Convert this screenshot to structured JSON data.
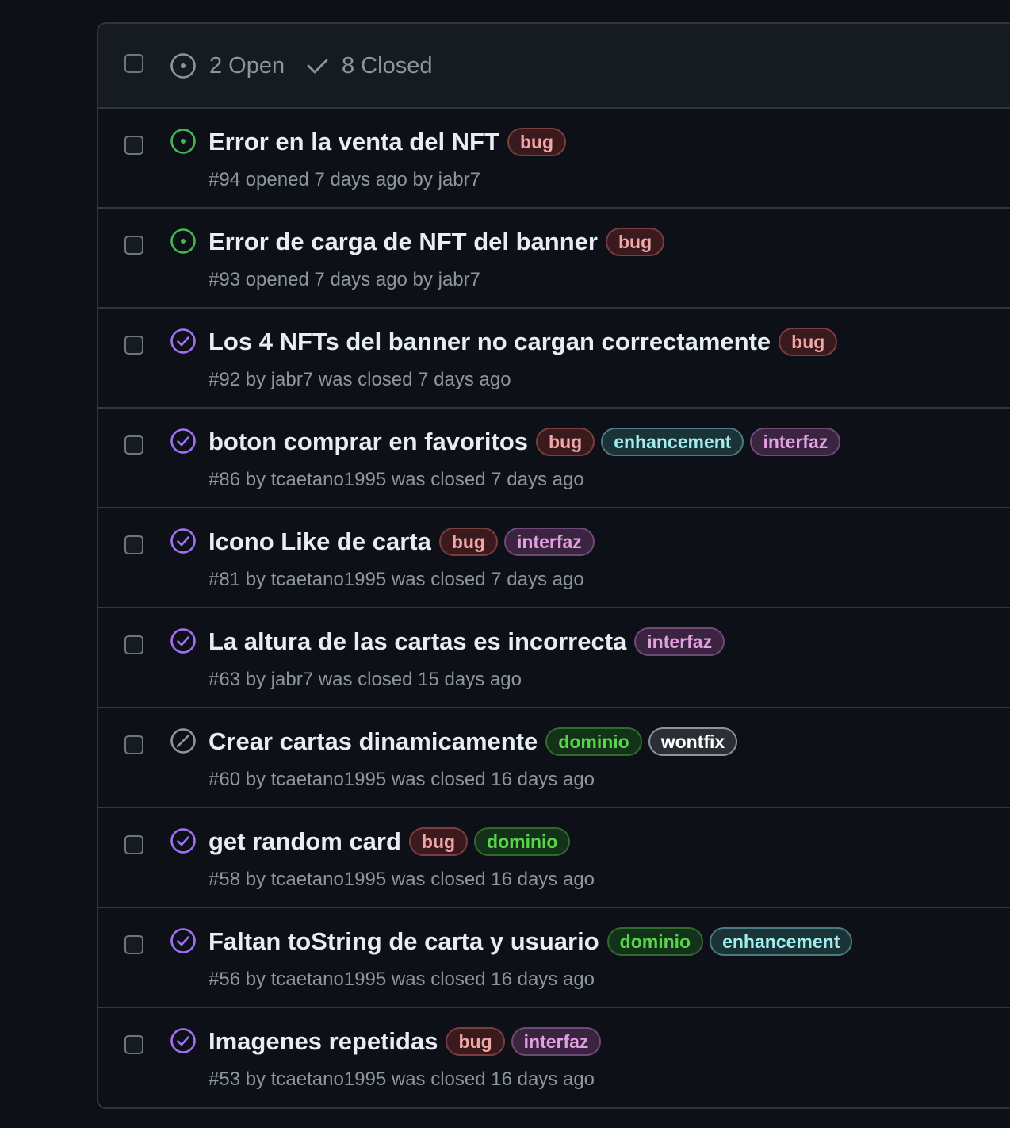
{
  "header": {
    "open_label": "2 Open",
    "closed_label": "8 Closed"
  },
  "colors": {
    "open": "#3fb950",
    "closed": "#a371f7",
    "not_planned": "#8d96a0"
  },
  "issues": [
    {
      "title": "Error en la venta del NFT",
      "state": "open",
      "state_icon": "issue-opened-icon",
      "labels": [
        {
          "name": "bug",
          "kind": "bug"
        }
      ],
      "meta": "#94 opened 7 days ago by jabr7"
    },
    {
      "title": "Error de carga de NFT del banner",
      "state": "open",
      "state_icon": "issue-opened-icon",
      "labels": [
        {
          "name": "bug",
          "kind": "bug"
        }
      ],
      "meta": "#93 opened 7 days ago by jabr7"
    },
    {
      "title": "Los 4 NFTs del banner no cargan correctamente",
      "state": "closed",
      "state_icon": "issue-closed-icon",
      "labels": [
        {
          "name": "bug",
          "kind": "bug"
        }
      ],
      "meta": "#92 by jabr7 was closed 7 days ago"
    },
    {
      "title": "boton comprar en favoritos",
      "state": "closed",
      "state_icon": "issue-closed-icon",
      "labels": [
        {
          "name": "bug",
          "kind": "bug"
        },
        {
          "name": "enhancement",
          "kind": "enhancement"
        },
        {
          "name": "interfaz",
          "kind": "interfaz"
        }
      ],
      "meta": "#86 by tcaetano1995 was closed 7 days ago"
    },
    {
      "title": "Icono Like de carta",
      "state": "closed",
      "state_icon": "issue-closed-icon",
      "labels": [
        {
          "name": "bug",
          "kind": "bug"
        },
        {
          "name": "interfaz",
          "kind": "interfaz"
        }
      ],
      "meta": "#81 by tcaetano1995 was closed 7 days ago"
    },
    {
      "title": "La altura de las cartas es incorrecta",
      "state": "closed",
      "state_icon": "issue-closed-icon",
      "labels": [
        {
          "name": "interfaz",
          "kind": "interfaz"
        }
      ],
      "meta": "#63 by jabr7 was closed 15 days ago"
    },
    {
      "title": "Crear cartas dinamicamente",
      "state": "not_planned",
      "state_icon": "skip-icon",
      "labels": [
        {
          "name": "dominio",
          "kind": "dominio"
        },
        {
          "name": "wontfix",
          "kind": "wontfix"
        }
      ],
      "meta": "#60 by tcaetano1995 was closed 16 days ago"
    },
    {
      "title": "get random card",
      "state": "closed",
      "state_icon": "issue-closed-icon",
      "labels": [
        {
          "name": "bug",
          "kind": "bug"
        },
        {
          "name": "dominio",
          "kind": "dominio"
        }
      ],
      "meta": "#58 by tcaetano1995 was closed 16 days ago"
    },
    {
      "title": "Faltan toString de carta y usuario",
      "state": "closed",
      "state_icon": "issue-closed-icon",
      "labels": [
        {
          "name": "dominio",
          "kind": "dominio"
        },
        {
          "name": "enhancement",
          "kind": "enhancement"
        }
      ],
      "meta": "#56 by tcaetano1995 was closed 16 days ago"
    },
    {
      "title": "Imagenes repetidas",
      "state": "closed",
      "state_icon": "issue-closed-icon",
      "labels": [
        {
          "name": "bug",
          "kind": "bug"
        },
        {
          "name": "interfaz",
          "kind": "interfaz"
        }
      ],
      "meta": "#53 by tcaetano1995 was closed 16 days ago"
    }
  ]
}
